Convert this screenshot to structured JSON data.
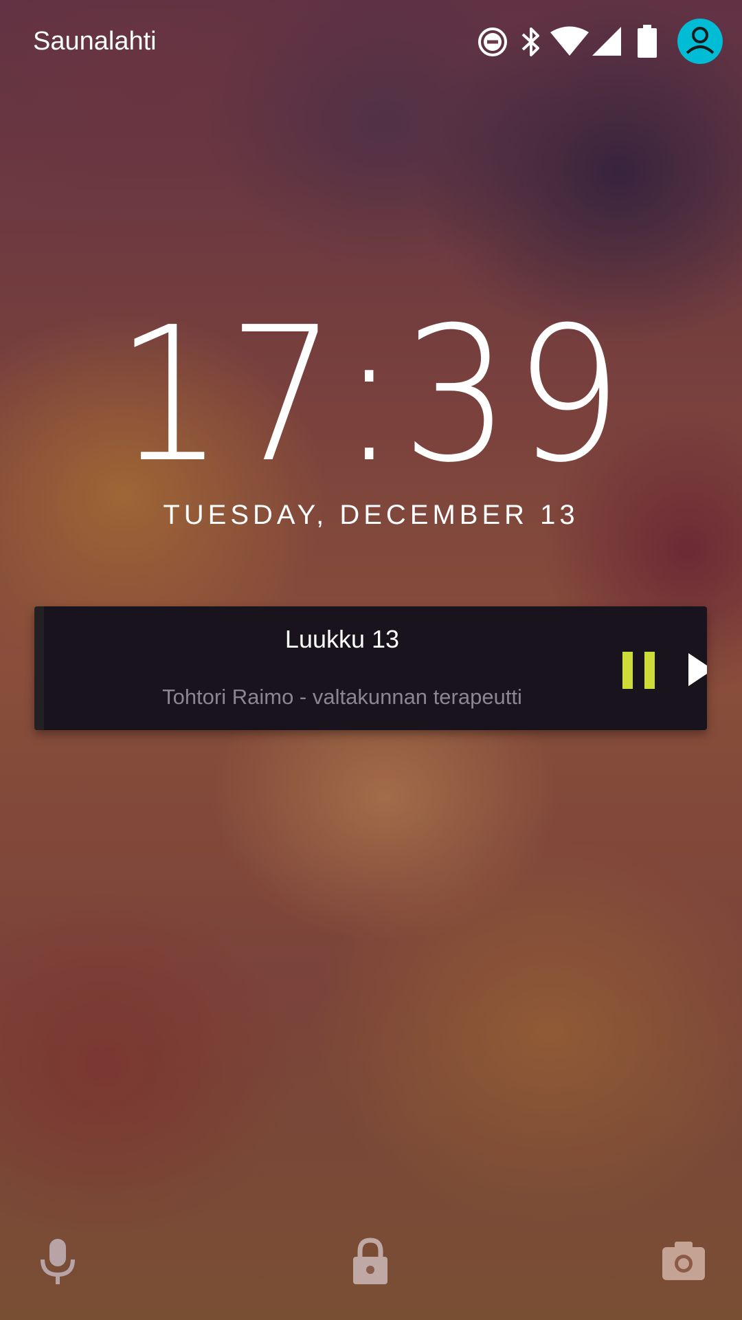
{
  "status_bar": {
    "carrier": "Saunalahti",
    "icons": [
      "do-not-disturb-icon",
      "bluetooth-icon",
      "wifi-icon",
      "cell-signal-icon",
      "battery-icon",
      "user-avatar-icon"
    ],
    "avatar_color": "#00bcd4"
  },
  "lockscreen": {
    "time": "17:39",
    "date": "TUESDAY, DECEMBER 13"
  },
  "media_notification": {
    "title": "Luukku 13",
    "subtitle": "Tohtori Raimo - valtakunnan terapeutti",
    "controls": [
      "pause-icon",
      "skip-next-icon"
    ],
    "accent_color": "#cddc39",
    "background_color": "#18131c"
  },
  "bottom_actions": {
    "icons": [
      "microphone-icon",
      "lock-icon",
      "camera-icon"
    ]
  }
}
